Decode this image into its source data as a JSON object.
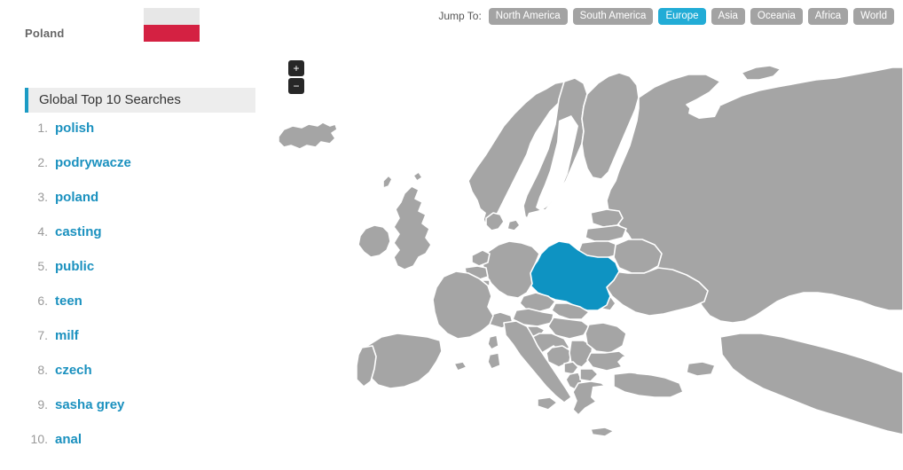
{
  "country": {
    "name": "Poland",
    "flag": {
      "top_color": "#e7e7e7",
      "bottom_color": "#d42142"
    }
  },
  "searches_panel": {
    "title": "Global Top 10 Searches",
    "accent_color": "#1b9bc4",
    "items": [
      {
        "rank": "1.",
        "term": "polish"
      },
      {
        "rank": "2.",
        "term": "podrywacze"
      },
      {
        "rank": "3.",
        "term": "poland"
      },
      {
        "rank": "4.",
        "term": "casting"
      },
      {
        "rank": "5.",
        "term": "public"
      },
      {
        "rank": "6.",
        "term": "teen"
      },
      {
        "rank": "7.",
        "term": "milf"
      },
      {
        "rank": "8.",
        "term": "czech"
      },
      {
        "rank": "9.",
        "term": "sasha grey"
      },
      {
        "rank": "10.",
        "term": "anal"
      }
    ]
  },
  "jump_to": {
    "label": "Jump To:",
    "active_color": "#22acd6",
    "inactive_color": "#a3a3a3",
    "regions": [
      {
        "label": "North America",
        "active": false
      },
      {
        "label": "South America",
        "active": false
      },
      {
        "label": "Europe",
        "active": true
      },
      {
        "label": "Asia",
        "active": false
      },
      {
        "label": "Oceania",
        "active": false
      },
      {
        "label": "Africa",
        "active": false
      },
      {
        "label": "World",
        "active": false
      }
    ]
  },
  "map": {
    "region": "Europe",
    "land_color": "#a5a5a5",
    "border_color": "#ffffff",
    "highlight_color": "#0e93c2",
    "water_color": "#ffffff",
    "highlighted_country": "Poland",
    "zoom_in_label": "+",
    "zoom_out_label": "−"
  }
}
